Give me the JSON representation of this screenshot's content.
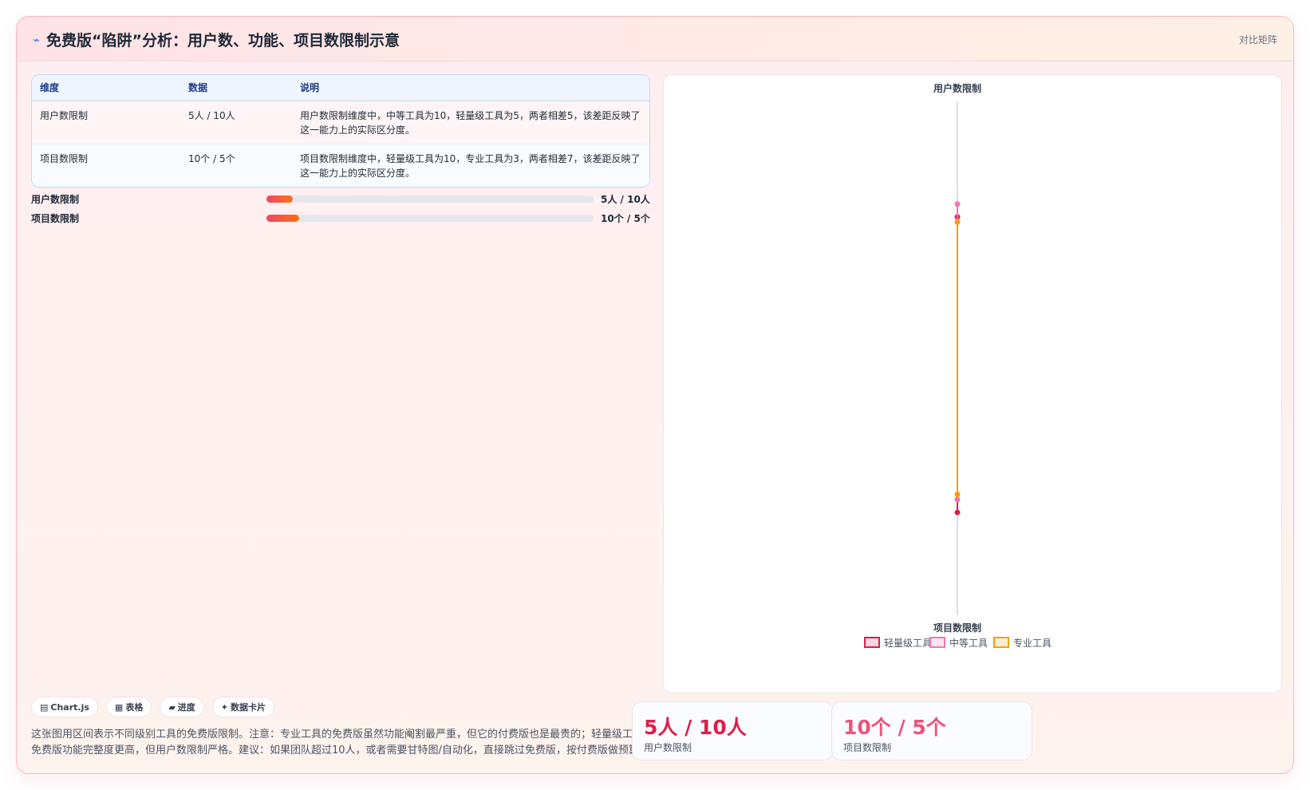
{
  "header": {
    "icon": "trend-icon",
    "title": "免费版“陷阱”分析：用户数、功能、项目数限制示意",
    "link": "对比矩阵"
  },
  "table": {
    "headers": [
      "维度",
      "数据",
      "说明"
    ],
    "rows": [
      [
        "用户数限制",
        "5人 / 10人",
        "用户数限制维度中，中等工具为10，轻量级工具为5，两者相差5，该差距反映了这一能力上的实际区分度。"
      ],
      [
        "项目数限制",
        "10个 / 5个",
        "项目数限制维度中，轻量级工具为10，专业工具为3，两者相差7，该差距反映了这一能力上的实际区分度。"
      ]
    ]
  },
  "progress": [
    {
      "label": "用户数限制",
      "value": "5人 / 10人",
      "fill": 0.08
    },
    {
      "label": "项目数限制",
      "value": "10个 / 5个",
      "fill": 0.1
    }
  ],
  "pills": [
    {
      "icon": "chart-icon",
      "glyph": "▤",
      "label": "Chart.js"
    },
    {
      "icon": "table-icon",
      "glyph": "▦",
      "label": "表格"
    },
    {
      "icon": "progress-icon",
      "glyph": "▰",
      "label": "进度"
    },
    {
      "icon": "card-icon",
      "glyph": "✦",
      "label": "数据卡片"
    }
  ],
  "note": "这张图用区间表示不同级别工具的免费版限制。注意：专业工具的免费版虽然功能阉割最严重，但它的付费版也是最贵的；轻量级工具的免费版功能完整度更高，但用户数限制严格。建议：如果团队超过10人，或者需要甘特图/自动化，直接跳过免费版，按付费版做预算。",
  "stats": [
    {
      "value": "5人 / 10人",
      "label": "用户数限制"
    },
    {
      "value": "10个 / 5个",
      "label": "项目数限制"
    }
  ],
  "chart_data": {
    "type": "radar",
    "axes": [
      "用户数限制",
      "项目数限制"
    ],
    "r_range": [
      -50,
      50
    ],
    "series": [
      {
        "name": "轻量级工具",
        "values": [
          5,
          10
        ],
        "color": "#e11d48"
      },
      {
        "name": "中等工具",
        "values": [
          10,
          5
        ],
        "color": "#f472b6"
      },
      {
        "name": "专业工具",
        "values": [
          3,
          3
        ],
        "color": "#f59e0b"
      }
    ],
    "legend": "bottom"
  }
}
